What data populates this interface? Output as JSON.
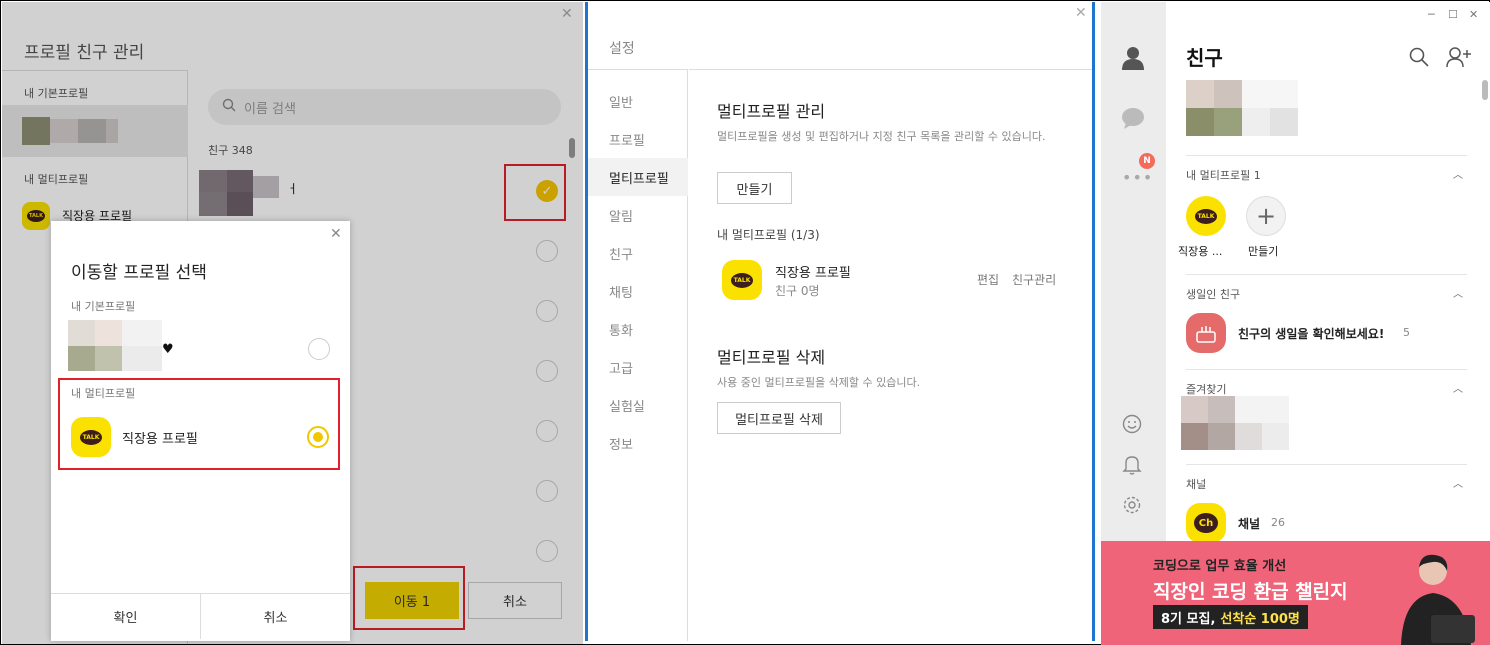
{
  "panel1": {
    "title": "프로필 친구 관리",
    "close_icon": "close-icon",
    "basic_profile_section": "내 기본프로필",
    "multi_profile_section": "내 멀티프로필",
    "multi_profile_name": "직장용 프로필",
    "search_placeholder": "이름 검색",
    "friends_count_label": "친구 348",
    "first_friend_name_suffix": "ㅓ",
    "move_button": "이동 1",
    "cancel_button": "취소",
    "modal": {
      "title": "이동할 프로필 선택",
      "basic_section": "내 기본프로필",
      "basic_suffix": "♥",
      "multi_section": "내 멀티프로필",
      "multi_name": "직장용 프로필",
      "talk_label": "TALK",
      "confirm": "확인",
      "cancel": "취소"
    }
  },
  "panel2": {
    "title": "설정",
    "menu": [
      "일반",
      "프로필",
      "멀티프로필",
      "알림",
      "친구",
      "채팅",
      "통화",
      "고급",
      "실험실",
      "정보"
    ],
    "active_menu": "멀티프로필",
    "manage_title": "멀티프로필 관리",
    "manage_desc": "멀티프로필을 생성 및 편집하거나 지정 친구 목록을 관리할 수 있습니다.",
    "create_button": "만들기",
    "my_multi_label": "내 멀티프로필 (1/3)",
    "profile_name": "직장용 프로필",
    "profile_sub": "친구 0명",
    "edit_link": "편집",
    "manage_friends_link": "친구관리",
    "delete_title": "멀티프로필 삭제",
    "delete_desc": "사용 중인 멀티프로필을 삭제할 수 있습니다.",
    "delete_button": "멀티프로필 삭제",
    "talk_label": "TALK"
  },
  "panel3": {
    "title": "친구",
    "window_controls": [
      "─",
      "☐",
      "✕"
    ],
    "badge": "N",
    "multi_section": "내 멀티프로필 1",
    "multi_item_name": "직장용 ...",
    "create_item": "만들기",
    "birthday_section": "생일인 친구",
    "birthday_text": "친구의 생일을 확인해보세요!",
    "birthday_count": "5",
    "favorites_section": "즐겨찾기",
    "channel_section": "채널",
    "channel_name": "채널",
    "channel_count": "26",
    "channel_icon_text": "Ch",
    "talk_label": "TALK",
    "ad": {
      "line1": "코딩으로 업무 효율 개선",
      "line2": "직장인 코딩 환급 챌린지",
      "line3a": "8기 모집,",
      "line3b": "선착순 100명"
    }
  },
  "colors": {
    "kakao_yellow": "#fae100",
    "highlight_red": "#e0212b",
    "divider_blue": "#1f73d1",
    "ad_pink": "#f0647a"
  }
}
